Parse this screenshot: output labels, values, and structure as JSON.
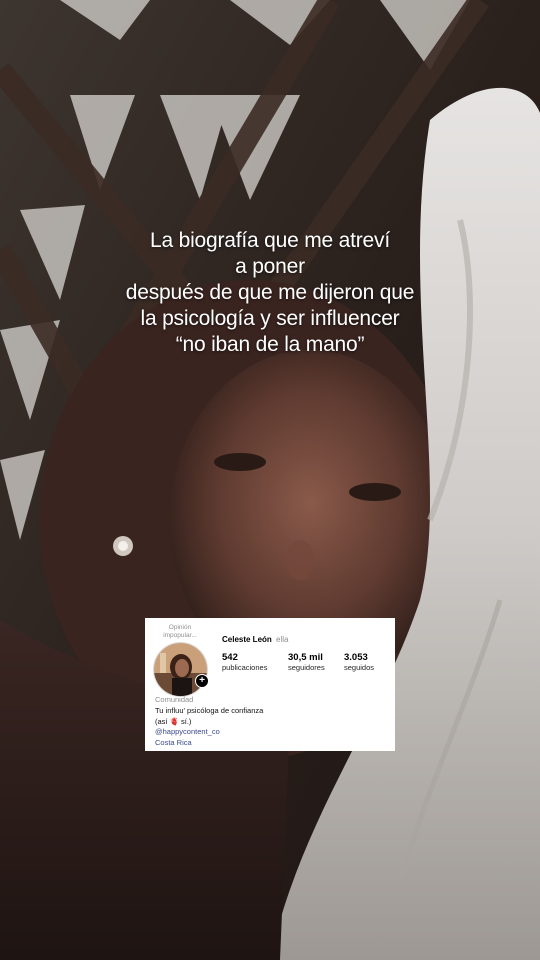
{
  "overlay": {
    "lines": [
      "La biografía que me atreví",
      "a poner",
      "después de que me dijeron que",
      "la psicología y ser influencer",
      "“no iban de la mano”"
    ]
  },
  "profile": {
    "note": "Opinión impopular...",
    "name": "Celeste León",
    "pronoun": "ella",
    "stats": [
      {
        "value": "542",
        "label": "publicaciones"
      },
      {
        "value": "30,5 mil",
        "label": "seguidores"
      },
      {
        "value": "3.053",
        "label": "seguidos"
      }
    ],
    "category": "Comunidad",
    "bio_line1": "Tu influu' psicóloga de confianza",
    "bio_line2": "(así 🫀 sí.)",
    "link": "@happycontent_co",
    "location": "Costa Rica",
    "add_icon": "plus-icon"
  },
  "colors": {
    "card_bg": "#ffffff",
    "link": "#3a4a8a",
    "muted": "#8e8e8e"
  }
}
